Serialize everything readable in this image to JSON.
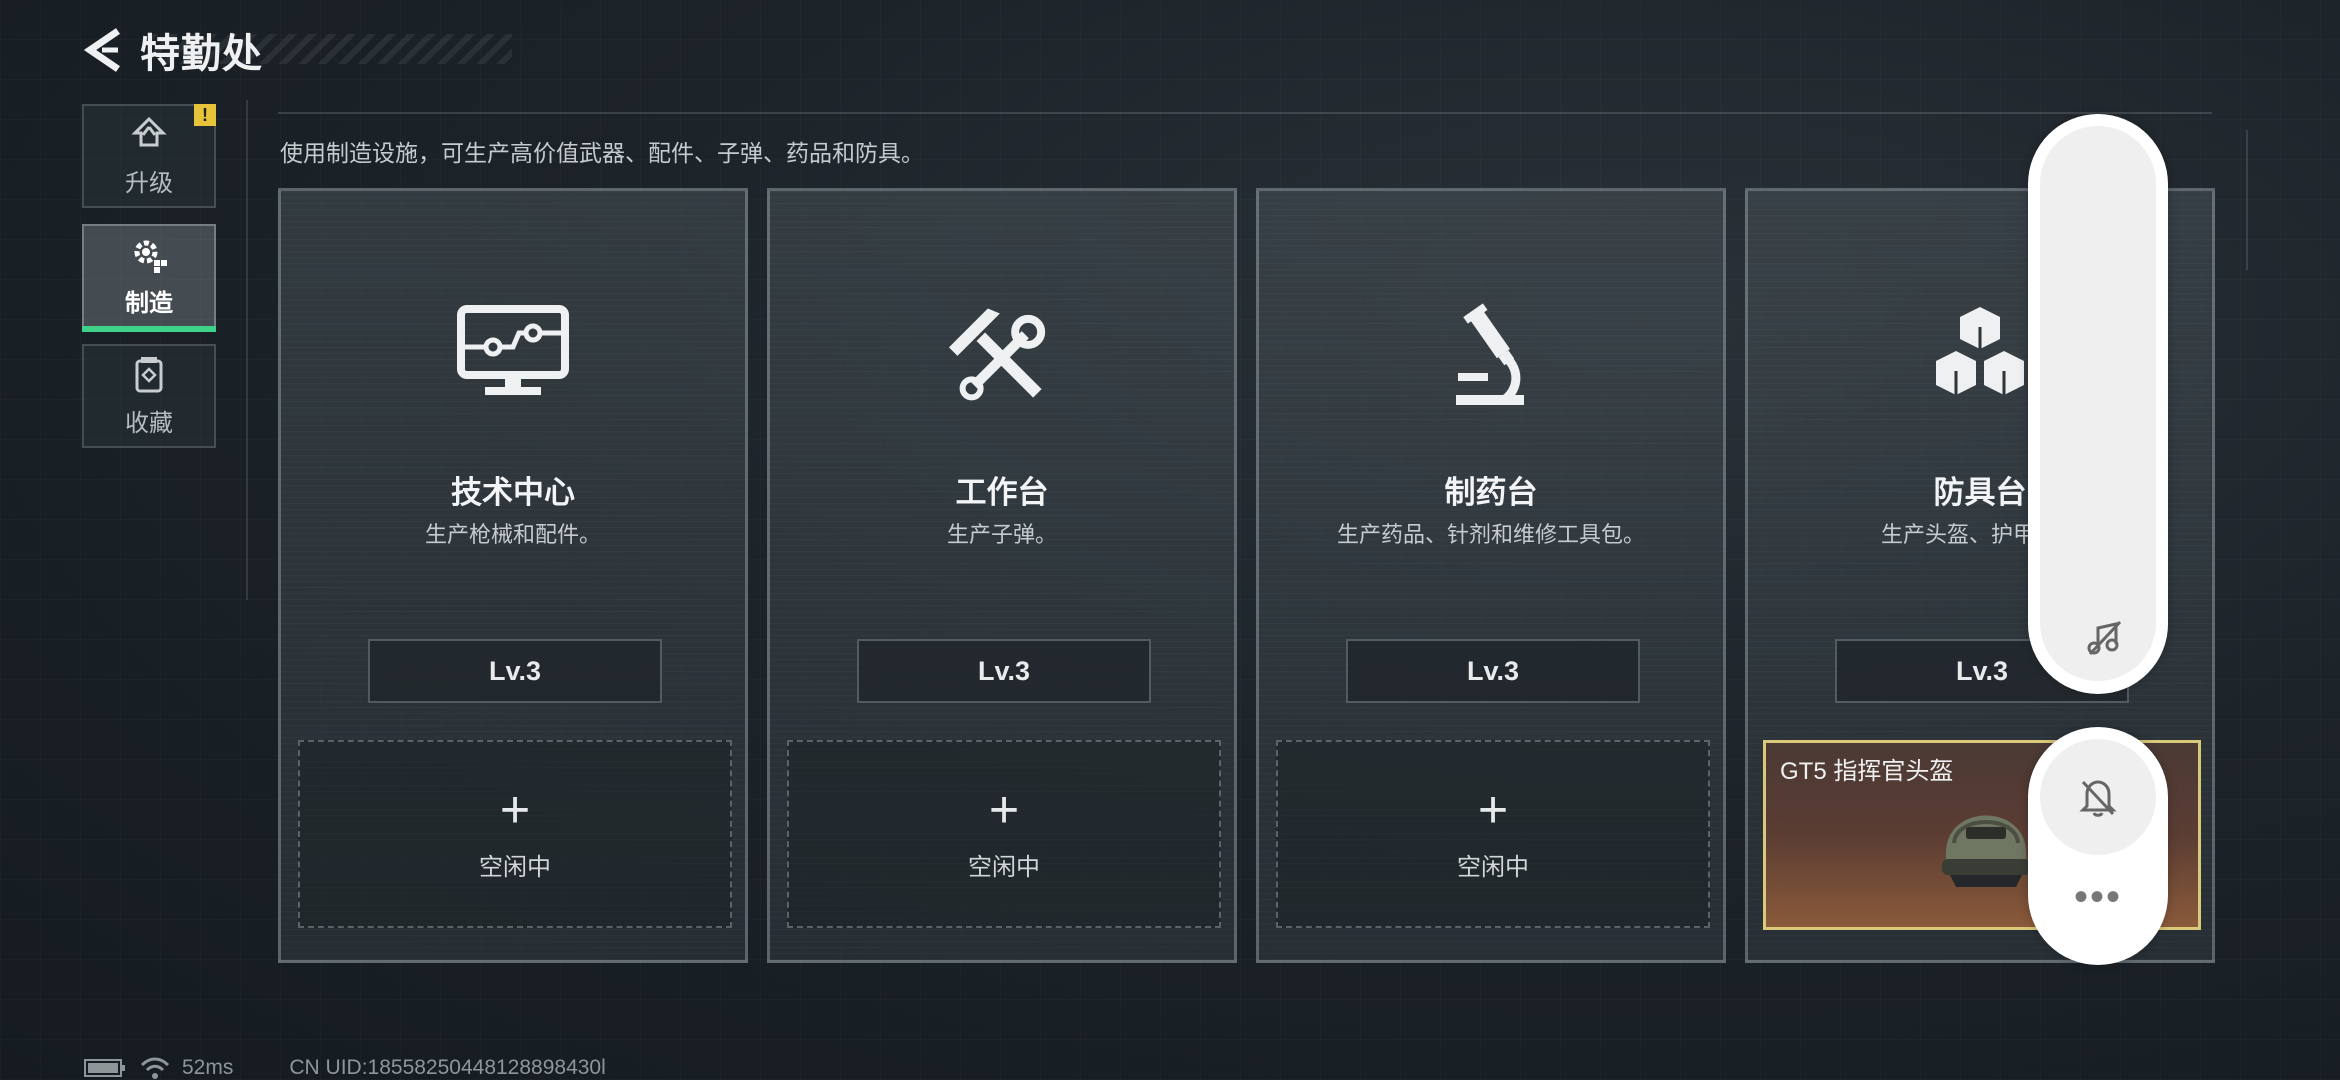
{
  "header": {
    "title": "特勤处"
  },
  "nav": [
    {
      "label": "升级",
      "icon": "upgrade-icon",
      "warning": "!"
    },
    {
      "label": "制造",
      "icon": "gear-icon"
    },
    {
      "label": "收藏",
      "icon": "collection-icon"
    }
  ],
  "description": "使用制造设施，可生产高价值武器、配件、子弹、药品和防具。",
  "cards": [
    {
      "name": "技术中心",
      "desc": "生产枪械和配件。",
      "level": "Lv.3",
      "icon": "monitor-icon",
      "slot_plus": "+",
      "slot_label": "空闲中"
    },
    {
      "name": "工作台",
      "desc": "生产子弹。",
      "level": "Lv.3",
      "icon": "hammer-wrench-icon",
      "slot_plus": "+",
      "slot_label": "空闲中"
    },
    {
      "name": "制药台",
      "desc": "生产药品、针剂和维修工具包。",
      "level": "Lv.3",
      "icon": "microscope-icon",
      "slot_plus": "+",
      "slot_label": "空闲中"
    },
    {
      "name": "防具台",
      "desc": "生产头盔、护甲、胸",
      "level": "Lv.3",
      "icon": "cubes-icon",
      "item_name": "GT5 指挥官头盔"
    }
  ],
  "overlay": {
    "more": "•••",
    "music_icon": "music-off-icon",
    "bell_icon": "bell-off-icon"
  },
  "status": {
    "ping": "52ms",
    "uid": "CN UID:18558250448128898430l"
  },
  "colors": {
    "active_accent": "#3fd38a",
    "warning": "#e7c33a",
    "item_border": "#d9c97a"
  }
}
